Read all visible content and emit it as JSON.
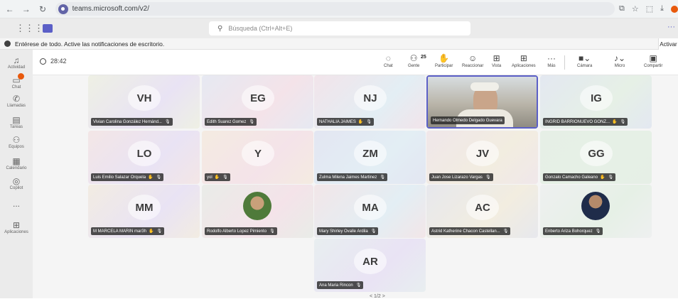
{
  "browser": {
    "url": "teams.microsoft.com/v2/"
  },
  "header": {
    "search_placeholder": "Búsqueda (Ctrl+Alt+E)"
  },
  "banner": {
    "text": "Entérese de todo. Active las notificaciones de escritorio.",
    "action": "Activar"
  },
  "rail": {
    "items": [
      {
        "label": "Actividad",
        "icon": "bell-icon"
      },
      {
        "label": "Chat",
        "icon": "chat-icon"
      },
      {
        "label": "Llamadas",
        "icon": "phone-icon"
      },
      {
        "label": "Tareas",
        "icon": "tasks-icon"
      },
      {
        "label": "Equipos",
        "icon": "teams-icon"
      },
      {
        "label": "Calendario",
        "icon": "calendar-icon"
      },
      {
        "label": "Copilot",
        "icon": "copilot-icon"
      },
      {
        "label": "...",
        "icon": "more-icon"
      },
      {
        "label": "Aplicaciones",
        "icon": "apps-add-icon"
      }
    ]
  },
  "toolbar": {
    "timer": "28:42",
    "chat": "Chat",
    "people": "Gente",
    "people_count": "25",
    "raise": "Participar",
    "react": "Reaccionar",
    "view": "Vista",
    "apps": "Aplicaciones",
    "more": "Más",
    "camera": "Cámara",
    "mic": "Micro",
    "share": "Compartir"
  },
  "participants": [
    {
      "initials": "VH",
      "name": "Vivian Carolina González Hernánd...",
      "hand": false,
      "bg": "#eef0e4"
    },
    {
      "initials": "EG",
      "name": "Edith Suarez Gomez",
      "hand": false,
      "bg": "#e6e9f2"
    },
    {
      "initials": "NJ",
      "name": "NATHALIA JAIMES",
      "hand": true,
      "bg": "#f2e4ea"
    },
    {
      "initials": "",
      "name": "Hernando Olmedo Delgado Guevara",
      "hand": false,
      "bg": "#c9c4b8",
      "video": true
    },
    {
      "initials": "IG",
      "name": "INGRID BARRIONUEVO GONZ...",
      "hand": true,
      "bg": "#e3e8f1"
    },
    {
      "initials": "LO",
      "name": "Luis Emilio Salazar Orquela",
      "hand": true,
      "bg": "#f3e6e6"
    },
    {
      "initials": "Y",
      "name": "yol",
      "hand": true,
      "bg": "#f4ebe1"
    },
    {
      "initials": "ZM",
      "name": "Zulma Milena Jaimes Martinez",
      "hand": false,
      "bg": "#e3e6f2"
    },
    {
      "initials": "JV",
      "name": "Juan Jose Lizarazo Vargas",
      "hand": false,
      "bg": "#f0e7ea"
    },
    {
      "initials": "GG",
      "name": "Gonzalo Camacho Galeano",
      "hand": true,
      "bg": "#e6efe6"
    },
    {
      "initials": "MM",
      "name": "M MARCELA MARIN mar3h",
      "hand": true,
      "bg": "#f2ece2"
    },
    {
      "initials": "",
      "name": "Rodolfo Alberto Lopez Pimiento",
      "hand": false,
      "bg": "#e9ece8",
      "photo": "green"
    },
    {
      "initials": "MA",
      "name": "Mary Shirley Ovalle Ardila",
      "hand": false,
      "bg": "#f2e6e8"
    },
    {
      "initials": "AC",
      "name": "Astrid Katherine Chacon Castellan...",
      "hand": false,
      "bg": "#e7e8ed"
    },
    {
      "initials": "",
      "name": "Enberto Ariza Bohorquez",
      "hand": false,
      "bg": "#eef0f0",
      "photo": "suit"
    },
    {
      "initials": "AR",
      "name": "Ana Maria Rincon",
      "hand": false,
      "bg": "#e8eef0"
    }
  ],
  "pager": "< 1/2 >"
}
